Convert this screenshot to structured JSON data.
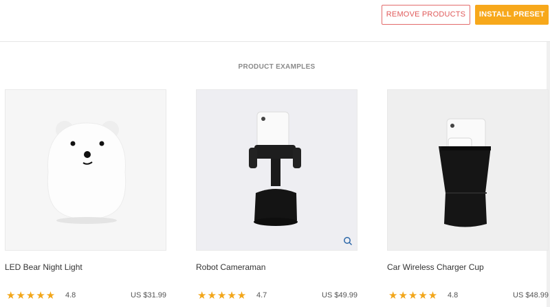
{
  "header": {
    "remove_label": "REMOVE PRODUCTS",
    "install_label": "INSTALL PRESET"
  },
  "section": {
    "title": "PRODUCT EXAMPLES"
  },
  "products": [
    {
      "name": "LED Bear Night Light",
      "stars": "★★★★★",
      "rating": "4.8",
      "price": "US $31.99",
      "image": "bear-lamp"
    },
    {
      "name": "Robot Cameraman",
      "stars": "★★★★★",
      "rating": "4.7",
      "price": "US $49.99",
      "image": "phone-stand"
    },
    {
      "name": "Car Wireless Charger Cup",
      "stars": "★★★★★",
      "rating": "4.8",
      "price": "US $48.99",
      "image": "charger-cup"
    }
  ],
  "colors": {
    "accent": "#f7a81b",
    "remove": "#e05a5a",
    "star": "#f2a61a"
  }
}
